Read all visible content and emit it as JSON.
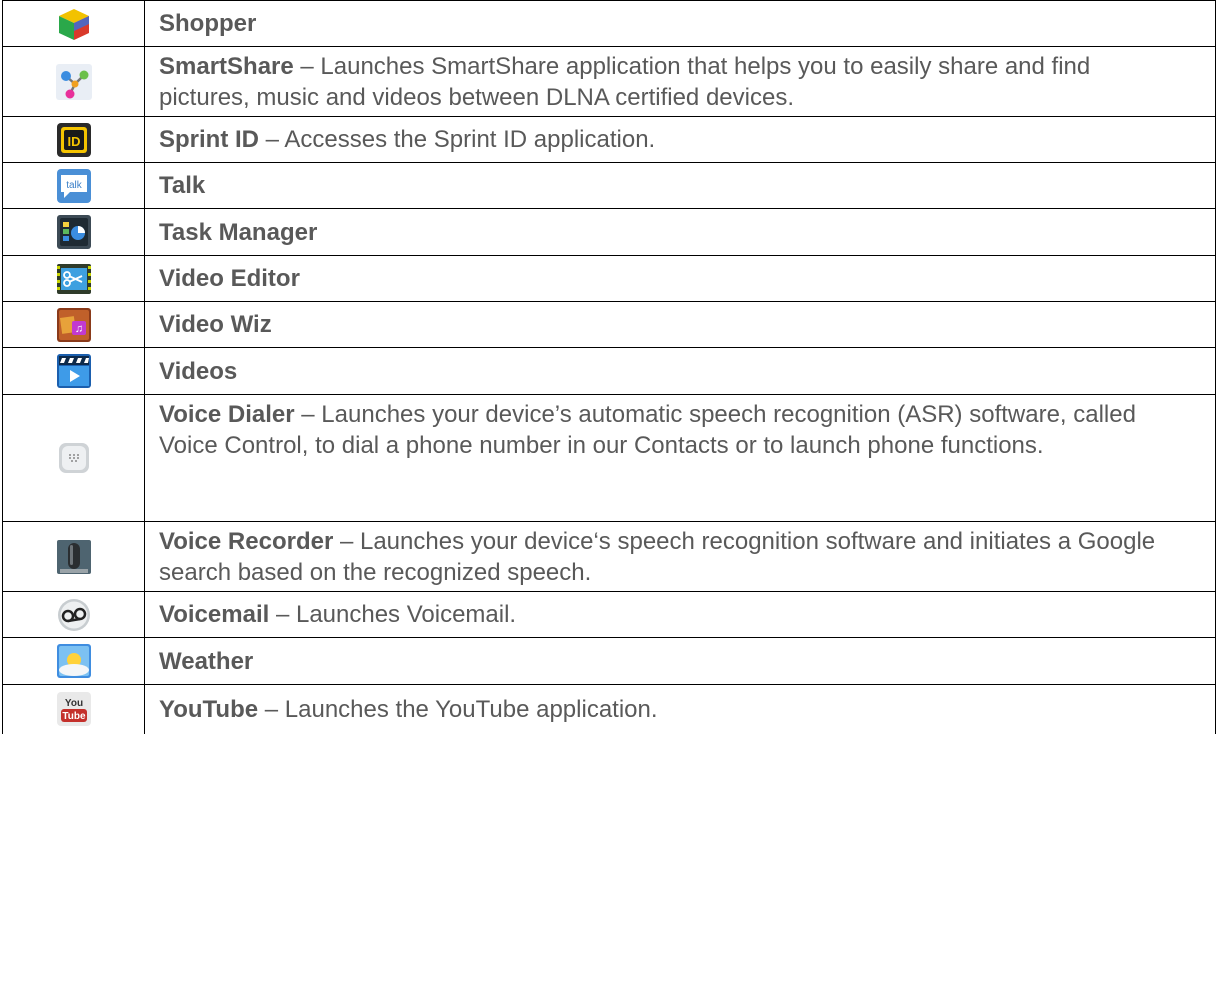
{
  "rows": [
    {
      "icon": "shopper-cube-icon",
      "name": "Shopper",
      "desc": ""
    },
    {
      "icon": "smartshare-molecule-icon",
      "name": "SmartShare",
      "desc": " – Launches SmartShare application that helps you to easily share and find pictures, music and videos between DLNA certified devices."
    },
    {
      "icon": "sprint-id-icon",
      "name": "Sprint ID",
      "desc": " – Accesses the Sprint ID application."
    },
    {
      "icon": "talk-bubble-icon",
      "name": "Talk",
      "desc": "",
      "icon_text": "talk"
    },
    {
      "icon": "task-manager-icon",
      "name": "Task Manager",
      "desc": ""
    },
    {
      "icon": "video-editor-scissors-icon",
      "name": "Video Editor",
      "desc": ""
    },
    {
      "icon": "video-wiz-icon",
      "name": "Video Wiz",
      "desc": ""
    },
    {
      "icon": "videos-clapper-icon",
      "name": "Videos",
      "desc": ""
    },
    {
      "icon": "voice-dialer-speaker-icon",
      "name": "Voice Dialer",
      "desc": " – Launches your device’s automatic speech recognition (ASR) software, called Voice Control, to dial a phone number in our Contacts or to launch phone functions."
    },
    {
      "icon": "voice-recorder-mic-icon",
      "name": "Voice Recorder",
      "desc": " – Launches your device‘s speech recognition software and initiates a Google search based on the recognized speech."
    },
    {
      "icon": "voicemail-icon",
      "name": "Voicemail",
      "desc": " – Launches Voicemail."
    },
    {
      "icon": "weather-sun-icon",
      "name": "Weather",
      "desc": ""
    },
    {
      "icon": "youtube-icon",
      "name": "YouTube",
      "desc": " – Launches the YouTube application.",
      "icon_text_top": "You",
      "icon_text_bottom": "Tube"
    }
  ]
}
